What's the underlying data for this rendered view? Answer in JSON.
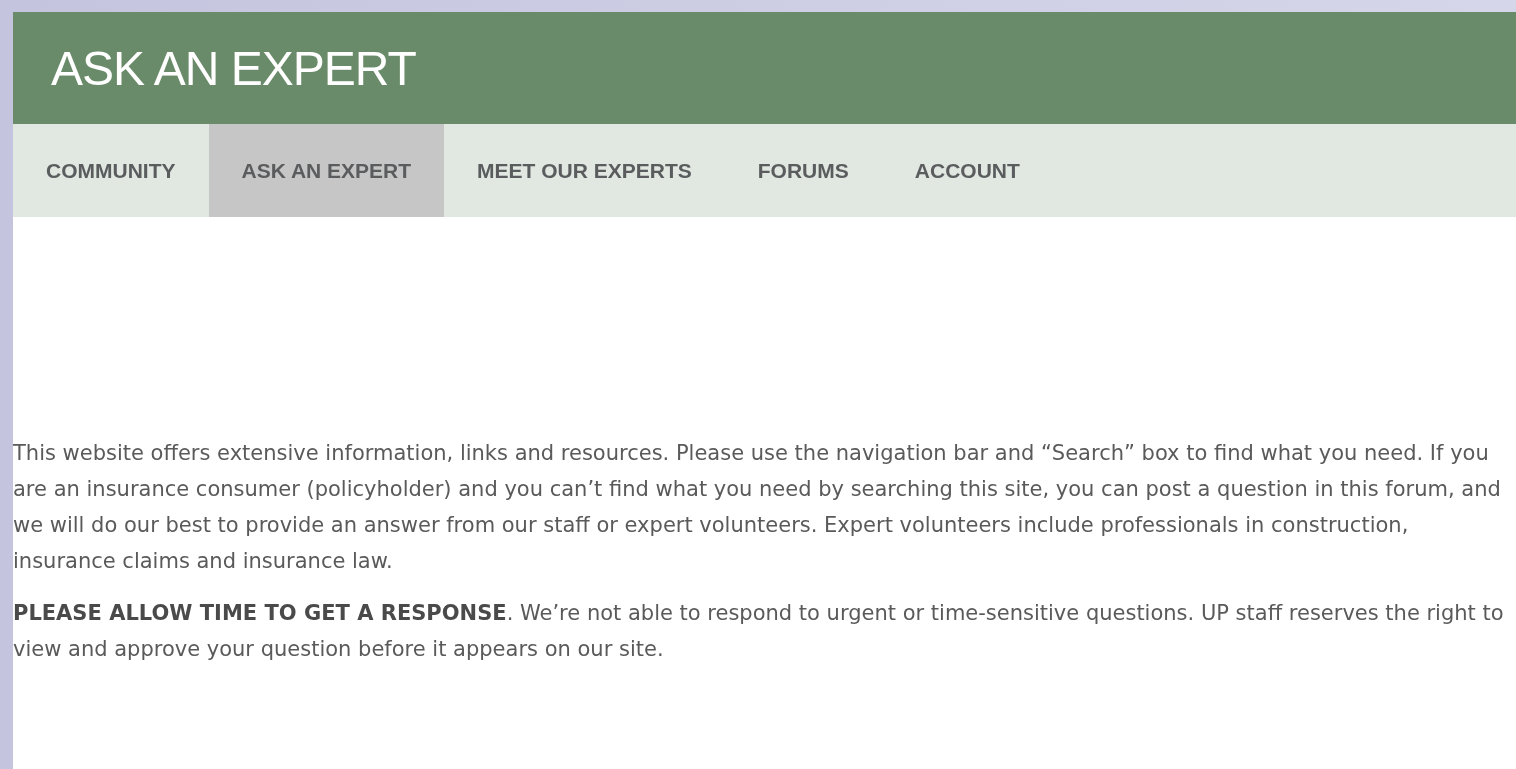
{
  "header": {
    "title": "ASK AN EXPERT"
  },
  "nav": [
    {
      "label": "COMMUNITY",
      "selected": false
    },
    {
      "label": "ASK AN EXPERT",
      "selected": true
    },
    {
      "label": "MEET OUR EXPERTS",
      "selected": false
    },
    {
      "label": "FORUMS",
      "selected": false
    },
    {
      "label": "ACCOUNT",
      "selected": false
    }
  ],
  "paragraphs": [
    "This website offers extensive information, links and resources. Please use the navigation bar and “Search” box to find what you need. If you are an insurance consumer (policyholder) and you can’t find what you need by searching this site, you can post a question in this forum, and we will do our best to provide an answer from our staff or expert volunteers. Expert volunteers include professionals in construction, insurance claims and insurance law.",
    "**PLEASE ALLOW TIME TO GET A RESPONSE**. We’re not able to respond to urgent or time-sensitive questions.  UP staff reserves the right to view and approve your question before it appears on our site."
  ]
}
